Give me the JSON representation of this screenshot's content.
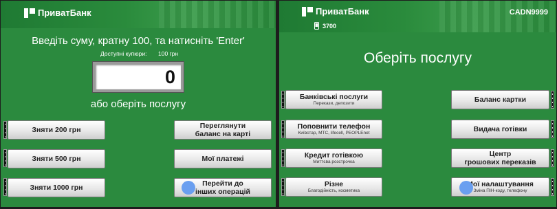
{
  "left": {
    "brand": "ПриватБанк",
    "instruction": "Введіть суму, кратну 100, та натисніть 'Enter'",
    "notes_label": "Доступні купюри:",
    "notes_value": "100 грн",
    "amount": "0",
    "alt_prompt": "або оберіть послугу",
    "buttons": {
      "w200": "Зняти 200 грн",
      "w500": "Зняти 500 грн",
      "w1000": "Зняти 1000 грн",
      "balance_line1": "Переглянути",
      "balance_line2": "баланс на карті",
      "payments": "Мої платежі",
      "other_line1": "Перейти до",
      "other_line2": "інших операцій"
    }
  },
  "right": {
    "brand": "ПриватБанк",
    "terminal_id": "CADN9999",
    "phone_code": "3700",
    "title": "Оберіть послугу",
    "buttons": {
      "bank_title": "Банківські послуги",
      "bank_sub": "Перекази, депозити",
      "topup_title": "Поповнити телефон",
      "topup_sub": "Київстар, МТС, lifecell, PEOPLEnet",
      "credit_title": "Кредит готівкою",
      "credit_sub": "Миттєва розстрочка",
      "misc_title": "Різне",
      "misc_sub": "Благодійність, косметика",
      "balance": "Баланс картки",
      "cash": "Видача готівки",
      "center_line1": "Центр",
      "center_line2": "грошових переказів",
      "settings_title": "Мої налаштування",
      "settings_sub": "Зміна ПІН-коду, телефону"
    }
  },
  "colors": {
    "screen_bg": "#2b8a3e",
    "button_face": "#f2f2f2",
    "accent_circle": "#6a9ff0"
  },
  "icons": [
    "privatbank-logo-icon",
    "phone-icon",
    "side-key-icon"
  ]
}
